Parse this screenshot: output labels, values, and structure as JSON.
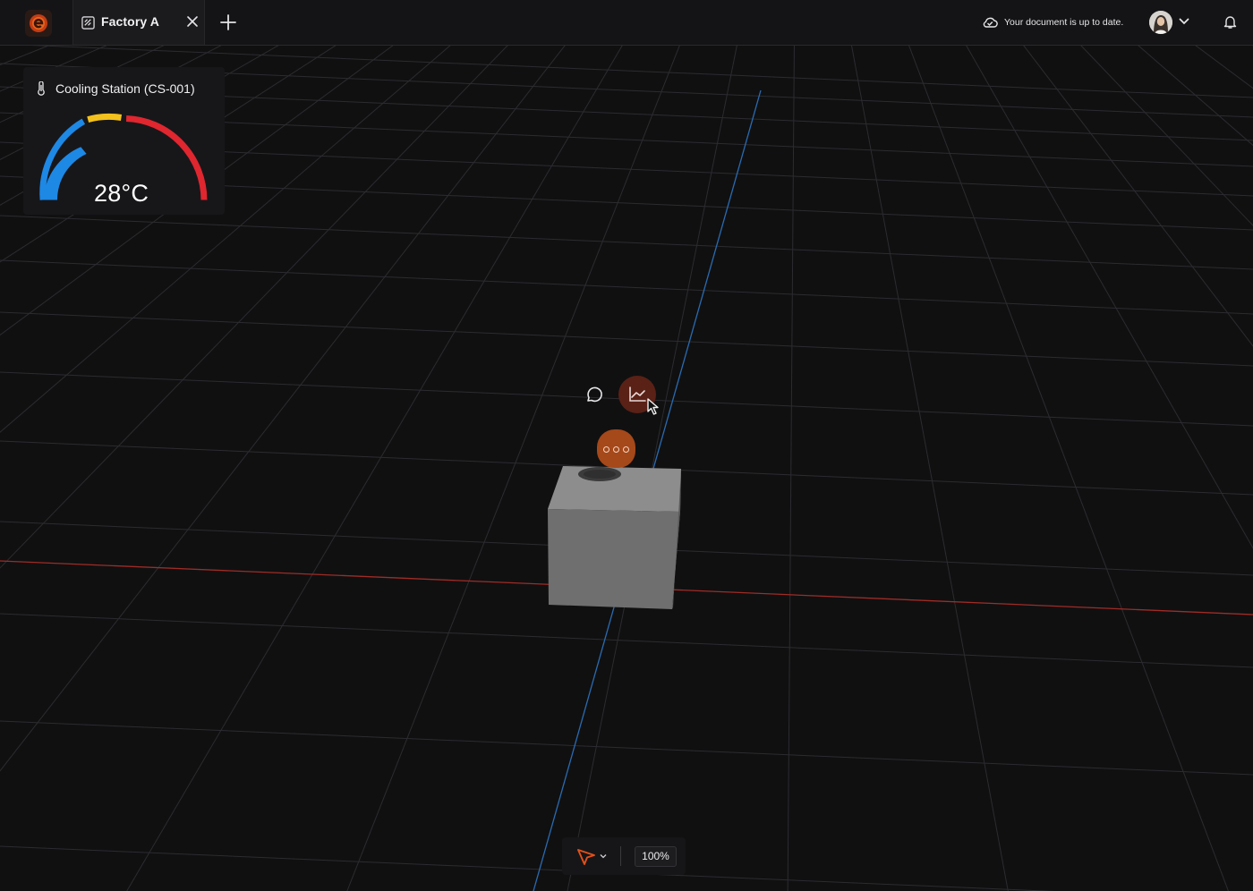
{
  "tabs": [
    {
      "label": "Factory A"
    }
  ],
  "status": {
    "sync_text": "Your document is up to date."
  },
  "gauge": {
    "title": "Cooling Station (CS-001)",
    "value_text": "28°C",
    "zone_colors": [
      "#1e88e5",
      "#f3c11d",
      "#e0262f"
    ]
  },
  "icons": {
    "app_logo": "app-logo-icon",
    "tab": "puzzle-icon",
    "close": "close-icon",
    "new_tab": "plus-icon",
    "sync": "cloud-check-icon",
    "dropdown": "chevron-down-icon",
    "notifications": "bell-icon",
    "thermometer": "thermometer-icon",
    "comment": "comment-icon",
    "chart": "line-chart-icon",
    "more": "more-dots-icon",
    "select": "pointer-arrow-icon"
  },
  "toolbar": {
    "zoom": "100%"
  },
  "colors": {
    "accent": "#e3501a",
    "x_axis": "#b8302a",
    "z_axis": "#2f73b9"
  }
}
